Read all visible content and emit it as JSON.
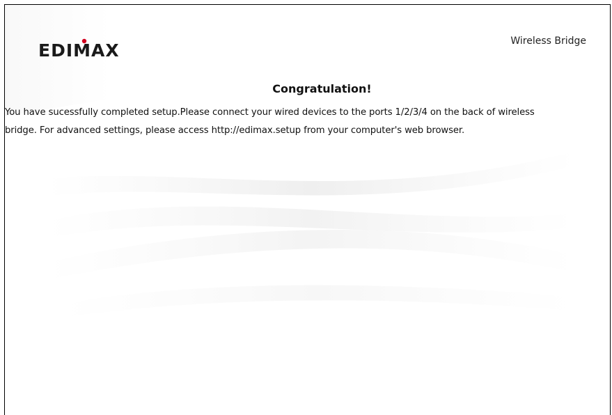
{
  "header": {
    "logo_text": "EDIMAX",
    "product_name": "Wireless Bridge"
  },
  "main": {
    "title": "Congratulation!",
    "message_line1": "You have sucessfully completed setup.Please connect your wired devices to the ports 1/2/3/4 on the back of wireless",
    "message_line2": "bridge. For advanced settings, please access http://edimax.setup from your computer's web browser."
  },
  "colors": {
    "logo": "#1a1a1a",
    "logo_accent": "#d2001e",
    "border": "#000000",
    "background": "#ffffff"
  }
}
